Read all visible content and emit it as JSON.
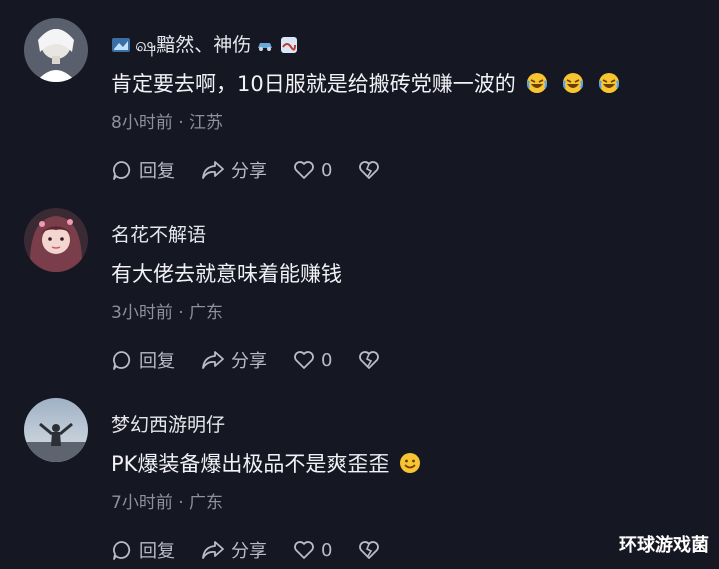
{
  "comments": [
    {
      "username": "ஷ黯然、神伤",
      "text": "肯定要去啊，10日服就是给搬砖党赚一波的",
      "emoji_count_label": "",
      "time_location": "8小时前 · 江苏",
      "reply_label": "回复",
      "share_label": "分享",
      "like_count": "",
      "avatar_icon": "white-hair-character-avatar",
      "trailing_emojis": [
        "rolling-laughing-emoji",
        "rolling-laughing-emoji",
        "rolling-laughing-emoji"
      ]
    },
    {
      "username": "名花不解语",
      "text": "有大佬去就意味着能赚钱",
      "time_location": "3小时前 · 广东",
      "reply_label": "回复",
      "share_label": "分享",
      "like_count": "0",
      "avatar_icon": "pink-hair-girl-avatar"
    },
    {
      "username": "梦幻西游明仔",
      "text": "PK爆装备爆出极品不是爽歪歪",
      "time_location": "7小时前 · 广东",
      "reply_label": "回复",
      "share_label": "分享",
      "like_count": "0",
      "avatar_icon": "silhouette-sky-avatar",
      "trailing_emojis": [
        "grinning-emoji"
      ]
    }
  ],
  "first_like_count": "0",
  "watermark": "环球游戏菌",
  "colors": {
    "background": "#151722",
    "meta_text": "#8e909c",
    "action_text": "#b9bbc6"
  }
}
